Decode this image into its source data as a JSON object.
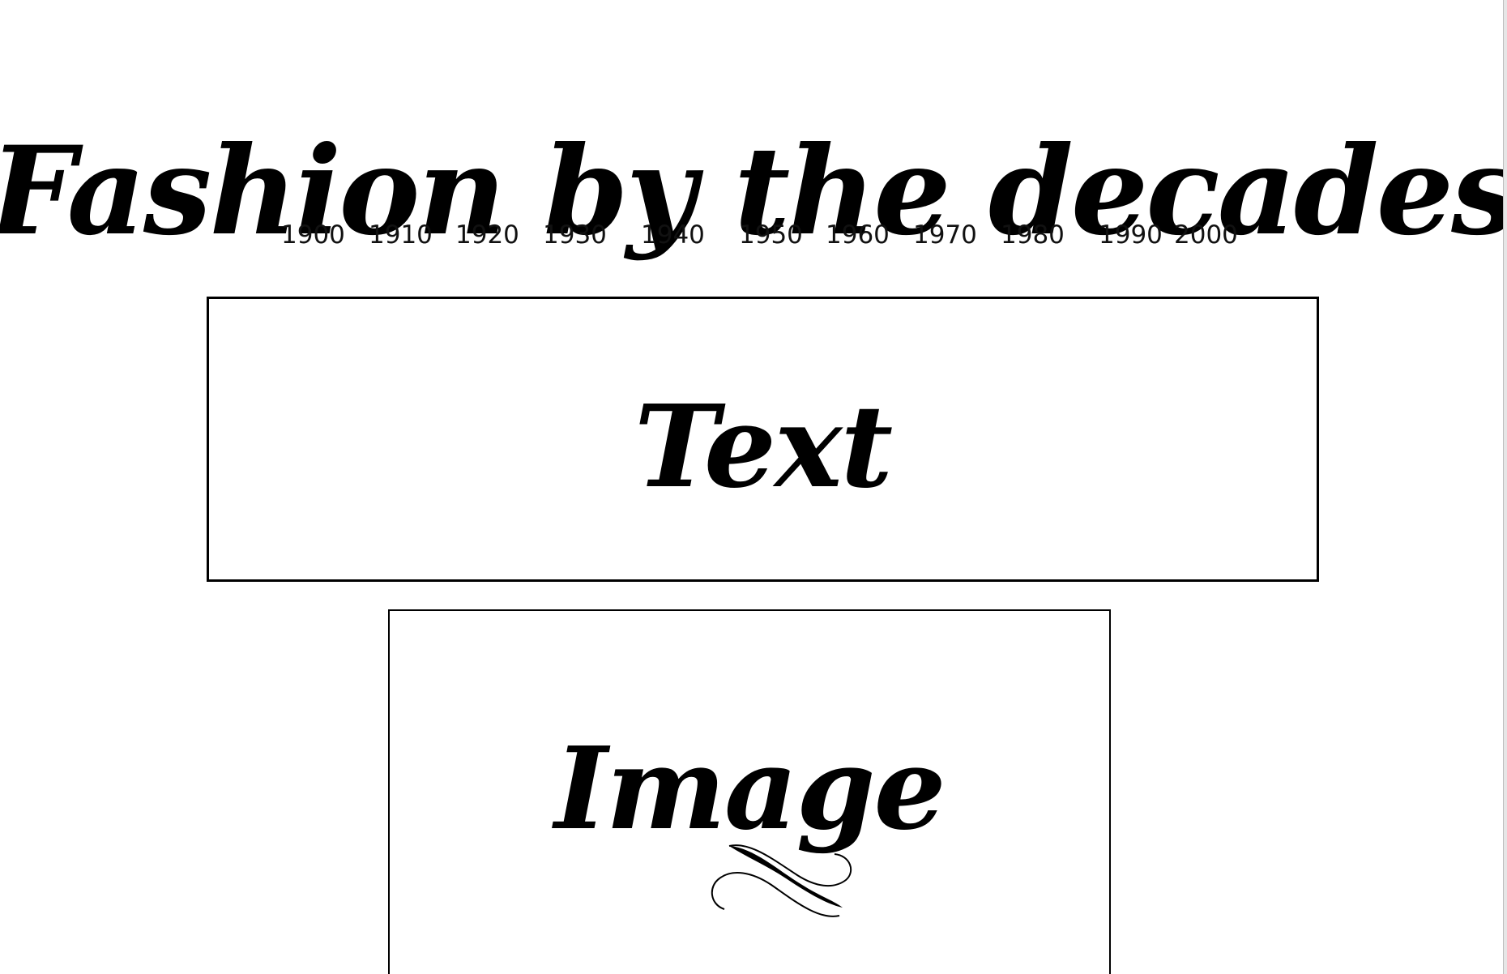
{
  "header": {
    "title": "Fashion by the decades"
  },
  "nav": {
    "decades": [
      "1900",
      "1910",
      "1920",
      "1930",
      "1940",
      "1950",
      "1960",
      "1970",
      "1980",
      "1990",
      "2000"
    ]
  },
  "main": {
    "text_box_label": "Text",
    "image_box_label": "Image"
  }
}
